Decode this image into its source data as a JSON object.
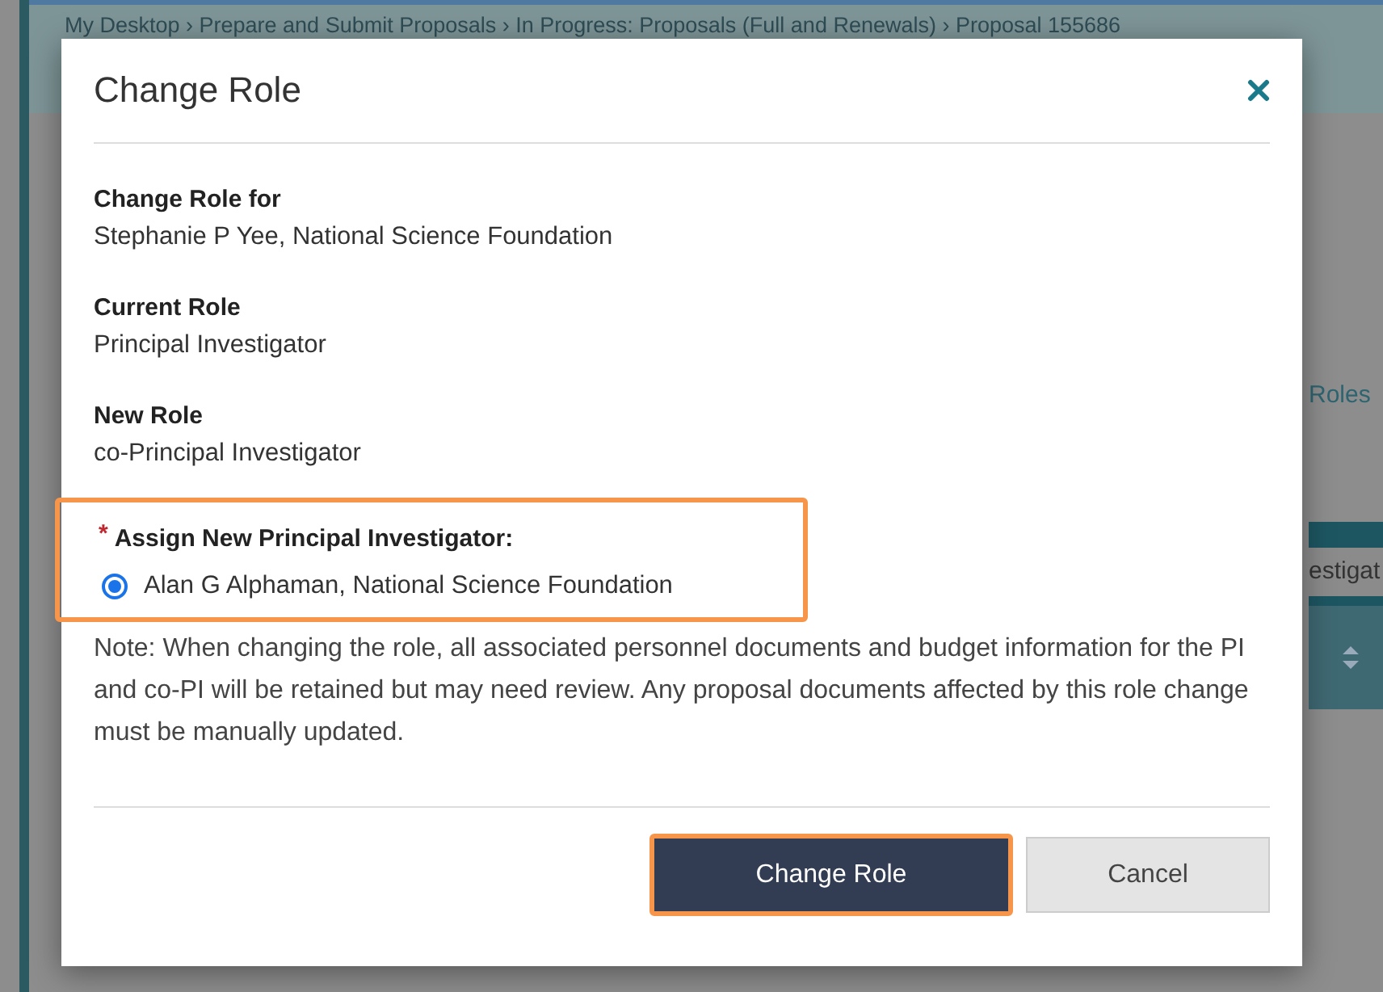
{
  "background": {
    "breadcrumb": "My Desktop › Prepare and Submit Proposals › In Progress: Proposals (Full and Renewals) › Proposal  155686",
    "roles_link": "Roles",
    "table_cell": "estigat"
  },
  "dialog": {
    "title": "Change Role",
    "fields": [
      {
        "label": "Change Role for",
        "value": "Stephanie P Yee, National Science Foundation"
      },
      {
        "label": "Current Role",
        "value": "Principal Investigator"
      },
      {
        "label": "New Role",
        "value": "co-Principal Investigator"
      }
    ],
    "assign": {
      "required_mark": "*",
      "label": "Assign New Principal Investigator:",
      "highlighted": true,
      "options": [
        {
          "label": "Alan G Alphaman, National Science Foundation",
          "selected": true
        }
      ]
    },
    "note": "Note: When changing the role, all associated personnel documents and budget information for the PI and co-PI will be retained but may need review. Any proposal documents affected by this role change must be manually updated.",
    "buttons": [
      {
        "label": "Change Role",
        "kind": "primary",
        "highlighted": true
      },
      {
        "label": "Cancel",
        "kind": "secondary",
        "highlighted": false
      }
    ]
  }
}
